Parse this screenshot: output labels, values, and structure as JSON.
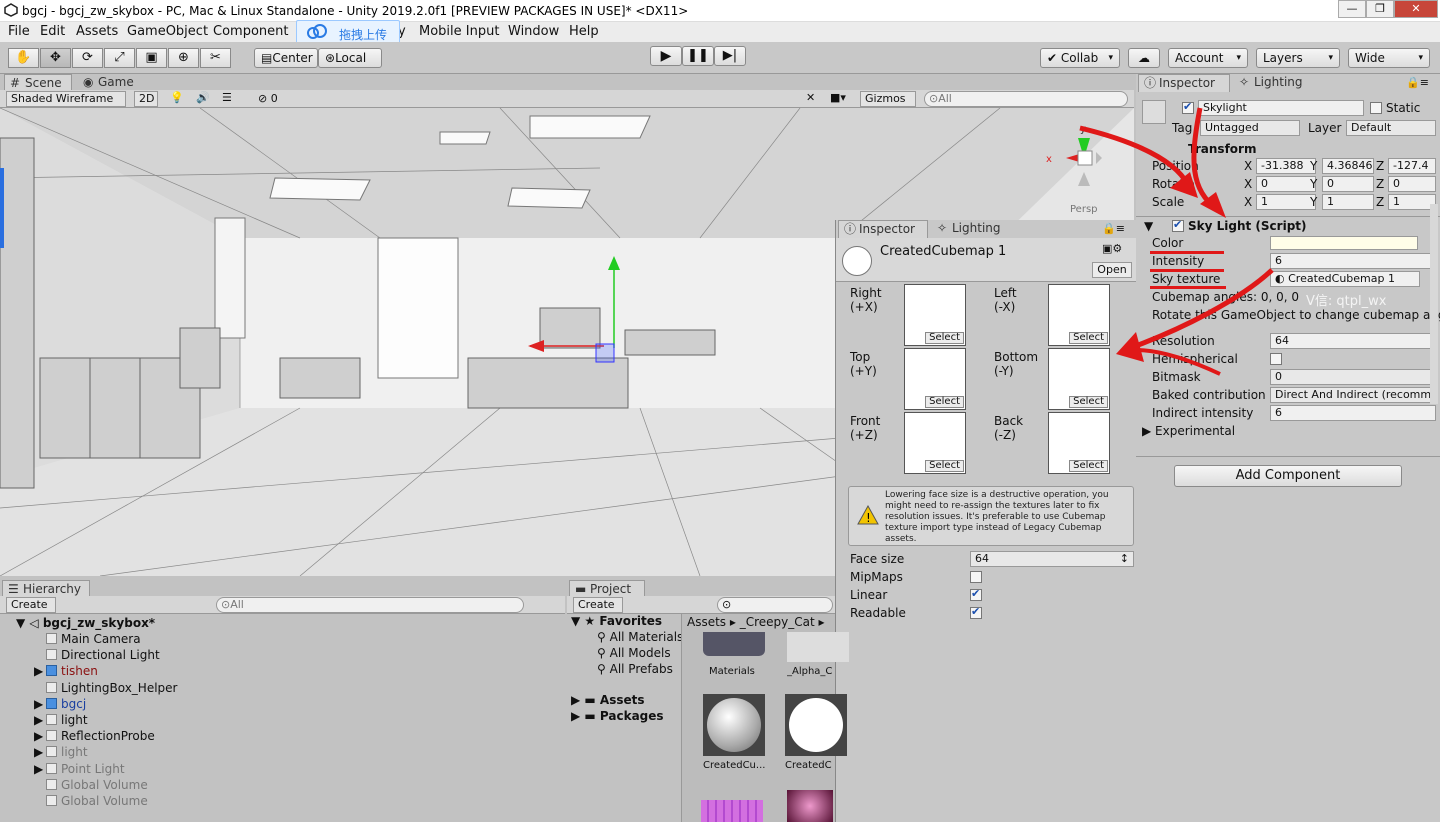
{
  "window": {
    "title": "bgcj - bgcj_zw_skybox - PC, Mac & Linux Standalone - Unity 2019.2.0f1 [PREVIEW PACKAGES IN USE]* <DX11>",
    "upload_label": "拖拽上传"
  },
  "menu": [
    "File",
    "Edit",
    "Assets",
    "GameObject",
    "Component",
    "y",
    "Mobile Input",
    "Window",
    "Help"
  ],
  "toolbar": {
    "center": "Center",
    "local": "Local",
    "collab": "Collab",
    "account": "Account",
    "layers": "Layers",
    "layout": "Wide"
  },
  "scene": {
    "tab_scene": "Scene",
    "tab_game": "Game",
    "shading": "Shaded Wireframe",
    "mode_2d": "2D",
    "hidden_count": "0",
    "gizmos": "Gizmos",
    "search_placeholder": "All",
    "persp": "Persp",
    "axis_x": "x",
    "axis_y": "y"
  },
  "inspector": {
    "tab_inspector": "Inspector",
    "tab_lighting": "Lighting",
    "object_name": "Skylight",
    "static_label": "Static",
    "tag_label": "Tag",
    "tag_value": "Untagged",
    "layer_label": "Layer",
    "layer_value": "Default",
    "transform": {
      "title": "Transform",
      "position_label": "Position",
      "rotation_label": "Rotatio",
      "scale_label": "Scale",
      "position": [
        "-31.388",
        "4.36846",
        "-127.4"
      ],
      "rotation": [
        "0",
        "0",
        "0"
      ],
      "scale": [
        "1",
        "1",
        "1"
      ]
    },
    "skylight": {
      "title": "Sky Light (Script)",
      "color_label": "Color",
      "intensity_label": "Intensity",
      "intensity_value": "6",
      "sky_texture_label": "Sky texture",
      "sky_texture_value": "CreatedCubemap 1",
      "cubemap_angles_label": "Cubemap angles:",
      "cubemap_angles_value": "0, 0, 0",
      "rotate_hint": "Rotate this GameObject to change cubemap angles",
      "resolution_label": "Resolution",
      "resolution_value": "64",
      "hemispherical_label": "Hemispherical",
      "bitmask_label": "Bitmask",
      "bitmask_value": "0",
      "baked_label": "Baked contribution",
      "baked_value": "Direct And Indirect (recommended)",
      "indirect_label": "Indirect intensity",
      "indirect_value": "6",
      "experimental_label": "Experimental"
    },
    "add_component": "Add Component",
    "watermark": "V信: qtpl_wx"
  },
  "cubemap_inspector": {
    "tab_inspector": "Inspector",
    "tab_lighting": "Lighting",
    "name": "CreatedCubemap 1",
    "open_button": "Open",
    "faces": [
      {
        "name": "Right",
        "axis": "(+X)"
      },
      {
        "name": "Left",
        "axis": "(-X)"
      },
      {
        "name": "Top",
        "axis": "(+Y)"
      },
      {
        "name": "Bottom",
        "axis": "(-Y)"
      },
      {
        "name": "Front",
        "axis": "(+Z)"
      },
      {
        "name": "Back",
        "axis": "(-Z)"
      }
    ],
    "select_label": "Select",
    "warning": "Lowering face size is a destructive operation, you might need to re-assign the textures later to fix resolution issues. It's preferable to use Cubemap texture import type instead of Legacy Cubemap assets.",
    "face_size_label": "Face size",
    "face_size_value": "64",
    "mipmaps_label": "MipMaps",
    "linear_label": "Linear",
    "readable_label": "Readable"
  },
  "hierarchy": {
    "tab": "Hierarchy",
    "create": "Create",
    "search_placeholder": "All",
    "scene_name": "bgcj_zw_skybox*",
    "items": [
      {
        "label": "Main Camera",
        "blue": false,
        "arrow": false,
        "dim": false
      },
      {
        "label": "Directional Light",
        "blue": false,
        "arrow": false,
        "dim": false
      },
      {
        "label": "tishen",
        "blue": true,
        "arrow": true,
        "dim": false,
        "red": true
      },
      {
        "label": "LightingBox_Helper",
        "blue": false,
        "arrow": false,
        "dim": false
      },
      {
        "label": "bgcj",
        "blue": true,
        "arrow": true,
        "dim": false,
        "bluetext": true
      },
      {
        "label": "light",
        "blue": false,
        "arrow": true,
        "dim": false
      },
      {
        "label": "ReflectionProbe",
        "blue": false,
        "arrow": true,
        "dim": false
      },
      {
        "label": "light",
        "blue": false,
        "arrow": true,
        "dim": true
      },
      {
        "label": "Point Light",
        "blue": false,
        "arrow": true,
        "dim": true
      },
      {
        "label": "Global Volume",
        "blue": false,
        "arrow": false,
        "dim": true
      },
      {
        "label": "Global Volume",
        "blue": false,
        "arrow": false,
        "dim": true
      }
    ]
  },
  "project": {
    "tab": "Project",
    "create": "Create",
    "favorites": "Favorites",
    "fav_items": [
      "All Materials",
      "All Models",
      "All Prefabs"
    ],
    "assets": "Assets",
    "packages": "Packages",
    "breadcrumb": [
      "Assets",
      "_Creepy_Cat"
    ],
    "thumbs": [
      "Materials",
      "_Alpha_C",
      "CreatedCu...",
      "CreatedC"
    ]
  }
}
